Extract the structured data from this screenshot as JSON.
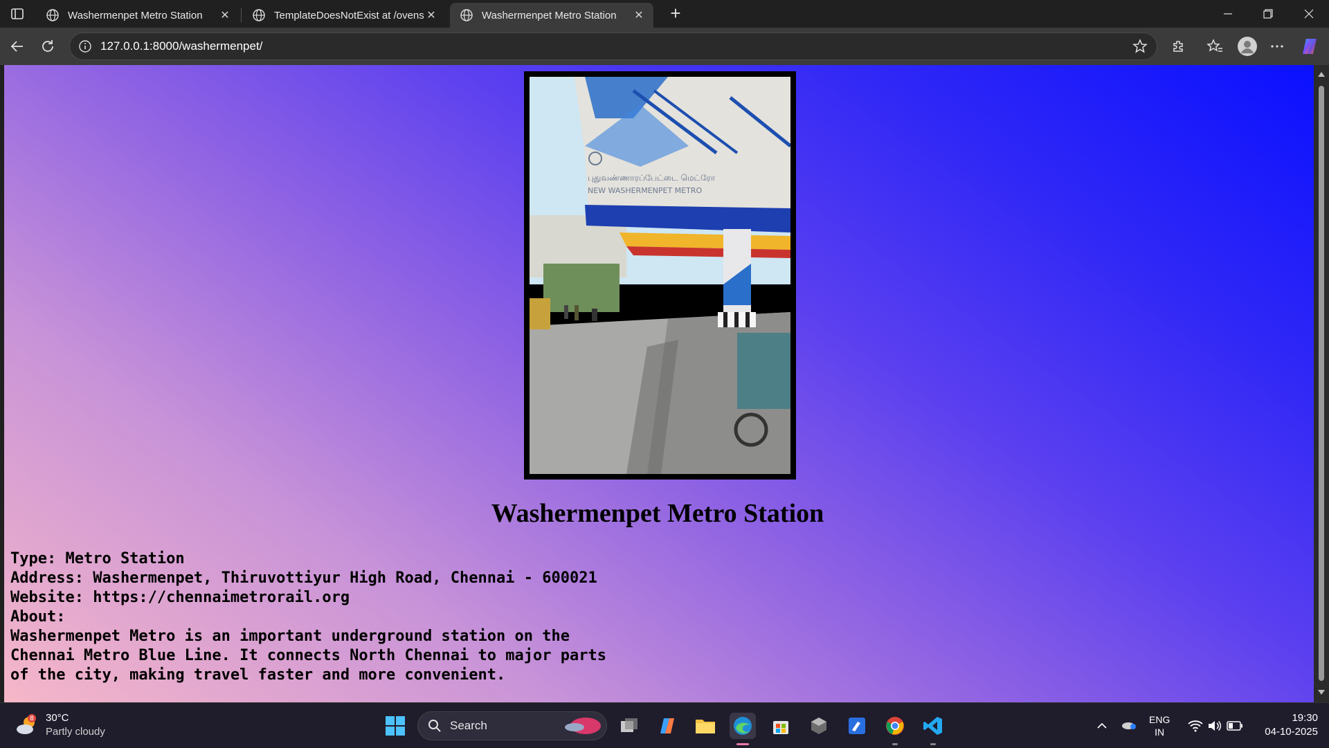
{
  "browser": {
    "tabs": [
      {
        "title": "Washermenpet Metro Station",
        "active": false
      },
      {
        "title": "TemplateDoesNotExist at /ovenstation/",
        "active": false
      },
      {
        "title": "Washermenpet Metro Station",
        "active": true
      }
    ],
    "new_tab_label": "+",
    "address": "127.0.0.1:8000/washermenpet/"
  },
  "page": {
    "photo_alt": "Washermenpet Metro Station",
    "photo_sign_tamil": "புதுவண்ணாரப்பேட்டை மெட்ரோ",
    "photo_sign_english": "NEW WASHERMENPET METRO",
    "title": "Washermenpet Metro Station",
    "type_line": "Type: Metro Station",
    "address_line": "Address: Washermenpet, Thiruvottiyur High Road, Chennai - 600021",
    "website_line": "Website: https://chennaimetrorail.org",
    "about_label": "About:",
    "about_text": "Washermenpet Metro is an important underground station on the Chennai Metro Blue Line. It connects North Chennai to major parts of the city, making travel faster and more convenient."
  },
  "taskbar": {
    "weather_temp": "30°C",
    "weather_cond": "Partly cloudy",
    "weather_badge": "8",
    "search_label": "Search",
    "lang_top": "ENG",
    "lang_bottom": "IN",
    "time": "19:30",
    "date": "04-10-2025"
  },
  "colors": {
    "page_gradient": [
      "#f6b7c8",
      "#c893d8",
      "#8e62e3",
      "#5a3ff0",
      "#0a10ff"
    ],
    "chrome_dark": "#202020",
    "toolbar": "#3b3b3b"
  },
  "icons": [
    "tab-actions-icon",
    "globe-icon",
    "close-icon",
    "back-icon",
    "reload-icon",
    "info-icon",
    "star-icon",
    "extensions-icon",
    "favorites-icon",
    "profile-icon",
    "more-icon",
    "copilot-icon",
    "windows-start-icon",
    "search-icon",
    "task-view-icon",
    "copilot-app-icon",
    "file-explorer-icon",
    "edge-icon",
    "store-icon",
    "app-icon",
    "vscode-icon",
    "chrome-icon",
    "wifi-icon",
    "volume-icon",
    "battery-icon"
  ]
}
